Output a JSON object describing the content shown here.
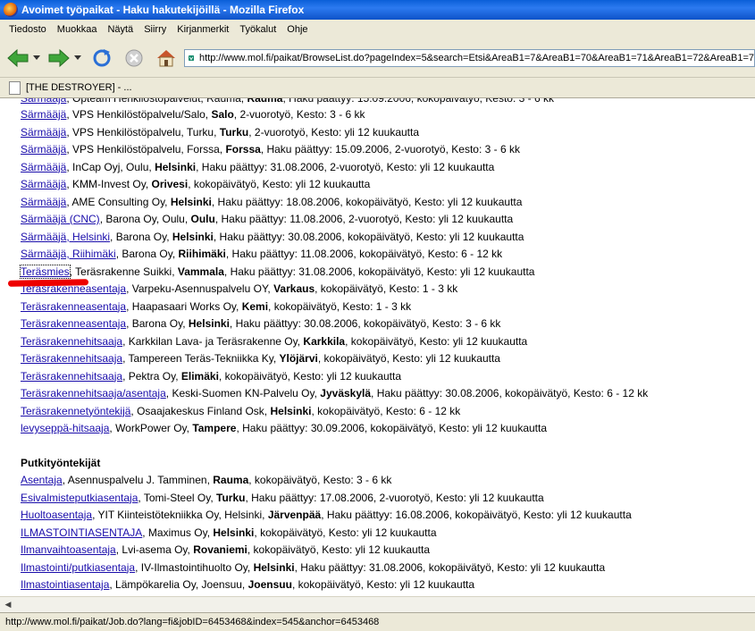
{
  "window": {
    "title": "Avoimet työpaikat - Haku hakutekijöillä - Mozilla Firefox"
  },
  "menu": [
    "Tiedosto",
    "Muokkaa",
    "Näytä",
    "Siirry",
    "Kirjanmerkit",
    "Työkalut",
    "Ohje"
  ],
  "address": {
    "url": "http://www.mol.fi/paikat/BrowseList.do?pageIndex=5&search=Etsi&AreaB1=7&AreaB1=70&AreaB1=71&AreaB1=72&AreaB1=7"
  },
  "bookmark": {
    "label": "[THE DESTROYER] - ..."
  },
  "status": {
    "text": "http://www.mol.fi/paikat/Job.do?lang=fi&jobID=6453468&index=545&anchor=6453468"
  },
  "rows": [
    {
      "link": "Särmääjä",
      "a": ", VPS Henkilöstöpalvelu/Salo, ",
      "b": "Salo",
      "c": ", 2-vuorotyö, Kesto: 3 - 6 kk"
    },
    {
      "link": "Särmääjä",
      "a": ", VPS Henkilöstöpalvelu, Turku, ",
      "b": "Turku",
      "c": ", 2-vuorotyö, Kesto: yli 12 kuukautta"
    },
    {
      "link": "Särmääjä",
      "a": ", VPS Henkilöstöpalvelu, Forssa, ",
      "b": "Forssa",
      "c": ", Haku päättyy: 15.09.2006, 2-vuorotyö, Kesto: 3 - 6 kk"
    },
    {
      "link": "Särmääjä",
      "a": ", InCap Oyj, Oulu, ",
      "b": "Helsinki",
      "c": ", Haku päättyy: 31.08.2006, 2-vuorotyö, Kesto: yli 12 kuukautta"
    },
    {
      "link": "Särmääjä",
      "a": ", KMM-Invest Oy, ",
      "b": "Orivesi",
      "c": ", kokopäivätyö, Kesto: yli 12 kuukautta"
    },
    {
      "link": "Särmääjä",
      "a": ", AME Consulting Oy, ",
      "b": "Helsinki",
      "c": ", Haku päättyy: 18.08.2006, kokopäivätyö, Kesto: yli 12 kuukautta"
    },
    {
      "link": "Särmääjä (CNC)",
      "a": ", Barona Oy, Oulu, ",
      "b": "Oulu",
      "c": ", Haku päättyy: 11.08.2006, 2-vuorotyö, Kesto: yli 12 kuukautta"
    },
    {
      "link": "Särmääjä, Helsinki",
      "a": ", Barona Oy, ",
      "b": "Helsinki",
      "c": ", Haku päättyy: 30.08.2006, kokopäivätyö, Kesto: yli 12 kuukautta"
    },
    {
      "link": "Särmääjä, Riihimäki",
      "a": ", Barona Oy, ",
      "b": "Riihimäki",
      "c": ", Haku päättyy: 11.08.2006, kokopäivätyö, Kesto: 6 - 12 kk"
    },
    {
      "link": "Teräsmies",
      "a": ", Teräsrakenne Suikki, ",
      "b": "Vammala",
      "c": ", Haku päättyy: 31.08.2006, kokopäivätyö, Kesto: yli 12 kuukautta"
    },
    {
      "link": "Teräsrakenneasentaja",
      "a": ", Varpeku-Asennuspalvelu OY, ",
      "b": "Varkaus",
      "c": ", kokopäivätyö, Kesto: 1 - 3 kk"
    },
    {
      "link": "Teräsrakenneasentaja",
      "a": ", Haapasaari Works Oy, ",
      "b": "Kemi",
      "c": ", kokopäivätyö, Kesto: 1 - 3 kk"
    },
    {
      "link": "Teräsrakenneasentaja",
      "a": ", Barona Oy, ",
      "b": "Helsinki",
      "c": ", Haku päättyy: 30.08.2006, kokopäivätyö, Kesto: 3 - 6 kk"
    },
    {
      "link": "Teräsrakennehitsaaja",
      "a": ", Karkkilan Lava- ja Teräsrakenne Oy, ",
      "b": "Karkkila",
      "c": ", kokopäivätyö, Kesto: yli 12 kuukautta"
    },
    {
      "link": "Teräsrakennehitsaaja",
      "a": ", Tampereen Teräs-Tekniikka Ky, ",
      "b": "Ylöjärvi",
      "c": ", kokopäivätyö, Kesto: yli 12 kuukautta"
    },
    {
      "link": "Teräsrakennehitsaaja",
      "a": ", Pektra Oy, ",
      "b": "Elimäki",
      "c": ", kokopäivätyö, Kesto: yli 12 kuukautta"
    },
    {
      "link": "Teräsrakennehitsaaja/asentaja",
      "a": ", Keski-Suomen KN-Palvelu Oy, ",
      "b": "Jyväskylä",
      "c": ", Haku päättyy: 30.08.2006, kokopäivätyö, Kesto: 6 - 12 kk"
    },
    {
      "link": "Teräsrakennetyöntekijä",
      "a": ", Osaajakeskus Finland Osk, ",
      "b": "Helsinki",
      "c": ", kokopäivätyö, Kesto: 6 - 12 kk"
    },
    {
      "link": "levyseppä-hitsaaja",
      "a": ", WorkPower Oy, ",
      "b": "Tampere",
      "c": ", Haku päättyy: 30.09.2006, kokopäivätyö, Kesto: yli 12 kuukautta"
    }
  ],
  "section2": {
    "heading": "Putkityöntekijät",
    "rows": [
      {
        "link": "Asentaja",
        "a": ", Asennuspalvelu J. Tamminen, ",
        "b": "Rauma",
        "c": ", kokopäivätyö, Kesto: 3 - 6 kk"
      },
      {
        "link": "Esivalmisteputkiasentaja",
        "a": ", Tomi-Steel Oy, ",
        "b": "Turku",
        "c": ", Haku päättyy: 17.08.2006, 2-vuorotyö, Kesto: yli 12 kuukautta"
      },
      {
        "link": "Huoltoasentaja",
        "a": ", YIT Kiinteistötekniikka Oy, Helsinki, ",
        "b": "Järvenpää",
        "c": ", Haku päättyy: 16.08.2006, kokopäivätyö, Kesto: yli 12 kuukautta"
      },
      {
        "link": "ILMASTOINTIASENTAJA",
        "a": ", Maximus Oy, ",
        "b": "Helsinki",
        "c": ", kokopäivätyö, Kesto: yli 12 kuukautta"
      },
      {
        "link": "Ilmanvaihtoasentaja",
        "a": ", Lvi-asema Oy, ",
        "b": "Rovaniemi",
        "c": ", kokopäivätyö, Kesto: yli 12 kuukautta"
      },
      {
        "link": "Ilmastointi/putkiasentaja",
        "a": ", IV-Ilmastointihuolto Oy, ",
        "b": "Helsinki",
        "c": ", Haku päättyy: 31.08.2006, kokopäivätyö, Kesto: yli 12 kuukautta"
      },
      {
        "link": "Ilmastointiasentaja",
        "a": ", Lämpökarelia Oy, Joensuu, ",
        "b": "Joensuu",
        "c": ", kokopäivätyö, Kesto: yli 12 kuukautta"
      }
    ]
  }
}
